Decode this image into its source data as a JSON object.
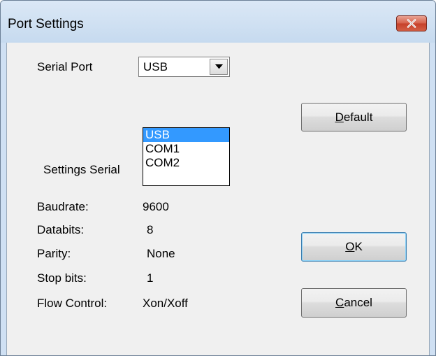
{
  "window": {
    "title": "Port Settings"
  },
  "serial_port": {
    "label": "Serial Port",
    "selected": "USB",
    "options": [
      "USB",
      "COM1",
      "COM2"
    ]
  },
  "settings": {
    "heading": "Settings Serial",
    "rows": [
      {
        "label": "Baudrate:",
        "value": "9600"
      },
      {
        "label": "Databits:",
        "value": "8"
      },
      {
        "label": "Parity:",
        "value": "None"
      },
      {
        "label": "Stop bits:",
        "value": "1"
      },
      {
        "label": "Flow Control:",
        "value": "Xon/Xoff"
      }
    ]
  },
  "buttons": {
    "default": {
      "mnemonic": "D",
      "rest": "efault"
    },
    "ok": {
      "mnemonic": "O",
      "rest": "K"
    },
    "cancel": {
      "mnemonic": "C",
      "rest": "ancel"
    }
  },
  "colors": {
    "selection": "#3399ff",
    "close_button": "#c6402a"
  }
}
